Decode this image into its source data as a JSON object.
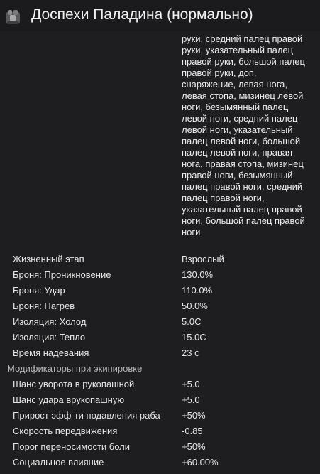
{
  "window": {
    "title": "Доспехи Паладина (нормально)",
    "icon": "armor-icon"
  },
  "body_parts_text": "руки, средний палец правой руки, указательный палец правой руки, большой палец правой руки, доп. снаряжение, левая нога, левая стопа, мизинец левой ноги, безымянный палец левой ноги, средний палец левой ноги, указательный палец левой ноги, большой палец левой ноги, правая нога, правая стопа, мизинец правой ноги, безымянный палец правой ноги, средний палец правой ноги, указательный палец правой ноги, большой палец правой ноги",
  "body_parts_lines": [
    "руки, средний палец правой",
    "руки, указательный палец",
    "правой руки, большой палец",
    "правой руки, доп.",
    "снаряжение, левая нога,",
    "левая стопа, мизинец левой",
    "ноги, безымянный палец",
    "левой ноги, средний палец",
    "левой ноги, указательный",
    "палец левой ноги, большой",
    "палец левой ноги, правая",
    "нога, правая стопа, мизинец",
    "правой ноги, безымянный",
    "палец правой ноги, средний",
    "палец правой ноги,",
    "указательный палец правой",
    "ноги, большой палец правой",
    "ноги"
  ],
  "stats": [
    {
      "label": "Жизненный этап",
      "value": "Взрослый"
    },
    {
      "label": "Броня: Проникновение",
      "value": "130.0%"
    },
    {
      "label": "Броня: Удар",
      "value": "110.0%"
    },
    {
      "label": "Броня: Нагрев",
      "value": "50.0%"
    },
    {
      "label": "Изоляция: Холод",
      "value": "5.0C"
    },
    {
      "label": "Изоляция: Тепло",
      "value": "15.0C"
    },
    {
      "label": "Время надевания",
      "value": "23 с"
    }
  ],
  "equip_section": {
    "header": "Модификаторы при экипировке",
    "rows": [
      {
        "label": "Шанс уворота в рукопашной",
        "value": "+5.0"
      },
      {
        "label": "Шанс удара врукопашную",
        "value": "+5.0"
      },
      {
        "label": "Прирост эфф-ти подавления раба",
        "value": "+50%"
      },
      {
        "label": "Скорость передвижения",
        "value": "-0.85"
      },
      {
        "label": "Порог переносимости боли",
        "value": "+50%"
      },
      {
        "label": "Социальное влияние",
        "value": "+60.00%"
      }
    ]
  }
}
